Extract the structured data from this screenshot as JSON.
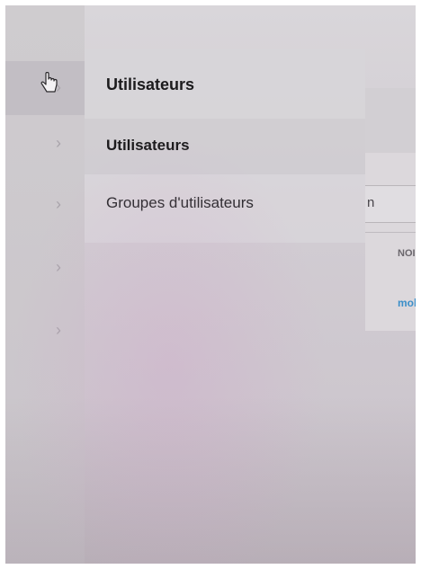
{
  "sidebar": {
    "chevrons": [
      "chevron-right-icon",
      "chevron-right-icon",
      "chevron-right-icon",
      "chevron-right-icon",
      "chevron-right-icon"
    ]
  },
  "flyout": {
    "title": "Utilisateurs",
    "items": [
      {
        "label": "Utilisateurs",
        "active": true
      },
      {
        "label": "Groupes d'utilisateurs",
        "active": false
      }
    ]
  },
  "background_panel": {
    "input_value": "n",
    "column_header": "NOI",
    "link_text": "mol"
  },
  "colors": {
    "link": "#3c8fc9",
    "text": "#1c1b1d"
  }
}
